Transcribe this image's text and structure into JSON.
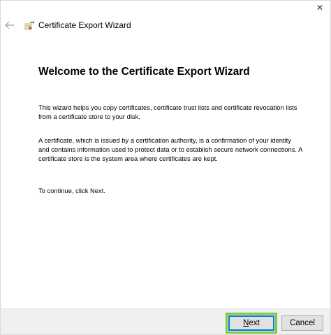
{
  "window": {
    "close_symbol": "✕",
    "title": "Certificate Export Wizard",
    "back_icon": "back-arrow-icon",
    "app_icon": "certificate-wizard-icon"
  },
  "content": {
    "heading": "Welcome to the Certificate Export Wizard",
    "paragraph1": "This wizard helps you copy certificates, certificate trust lists and certificate revocation lists from a certificate store to your disk.",
    "paragraph2": "A certificate, which is issued by a certification authority, is a confirmation of your identity and contains information used to protect data or to establish secure network connections. A certificate store is the system area where certificates are kept.",
    "paragraph3": "To continue, click Next."
  },
  "footer": {
    "next_label": "Next",
    "cancel_label": "Cancel",
    "focus_color": "#0078d7",
    "highlight_color": "#7ccb3f"
  }
}
